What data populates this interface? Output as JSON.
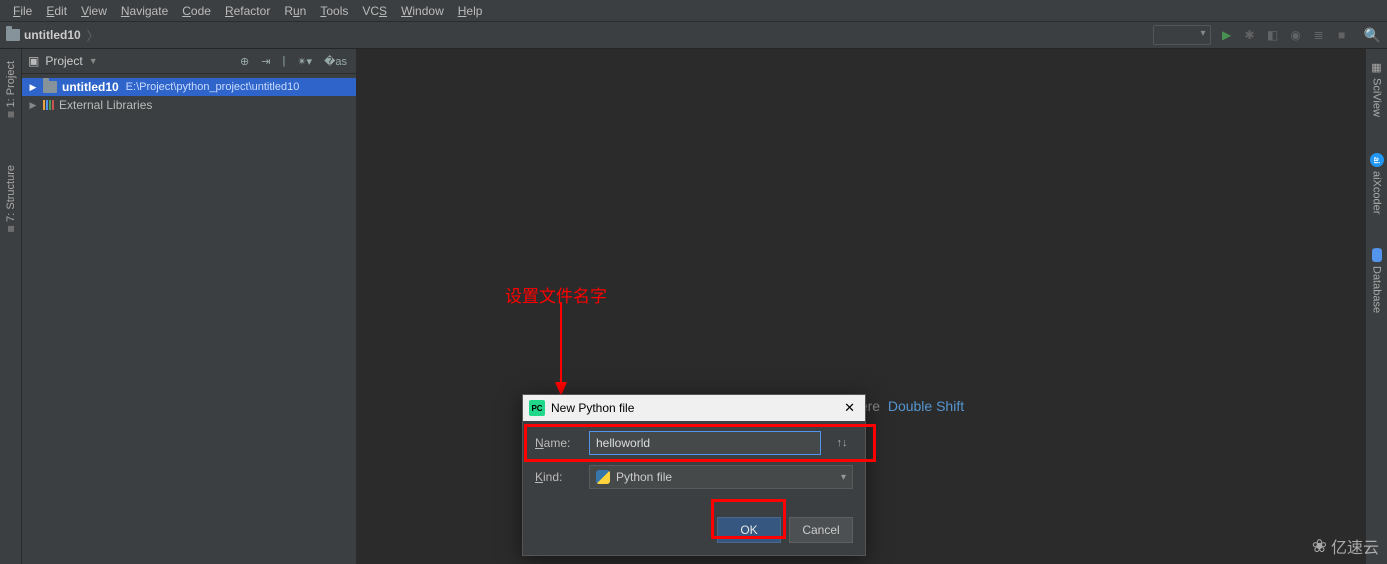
{
  "menu": {
    "file": "File",
    "edit": "Edit",
    "view": "View",
    "navigate": "Navigate",
    "code": "Code",
    "refactor": "Refactor",
    "run": "Run",
    "tools": "Tools",
    "vcs": "VCS",
    "window": "Window",
    "help": "Help"
  },
  "breadcrumb": {
    "project": "untitled10"
  },
  "sidebar_left": {
    "project_tab": "1: Project",
    "structure_tab": "7: Structure"
  },
  "sidebar_right": {
    "sciview": "SciView",
    "aixcoder": "aiXcoder",
    "database": "Database"
  },
  "project_panel": {
    "title": "Project",
    "tree": {
      "root_name": "untitled10",
      "root_path": "E:\\Project\\python_project\\untitled10",
      "external": "External Libraries"
    }
  },
  "editor_hint": {
    "line1_text": "Search Everywhere",
    "line1_kbd": "Double Shift"
  },
  "annotation": {
    "text": "设置文件名字"
  },
  "dialog": {
    "title": "New Python file",
    "name_label": "Name:",
    "name_value": "helloworld",
    "kind_label": "Kind:",
    "kind_value": "Python file",
    "ok": "OK",
    "cancel": "Cancel"
  },
  "watermark": {
    "text": "亿速云"
  }
}
